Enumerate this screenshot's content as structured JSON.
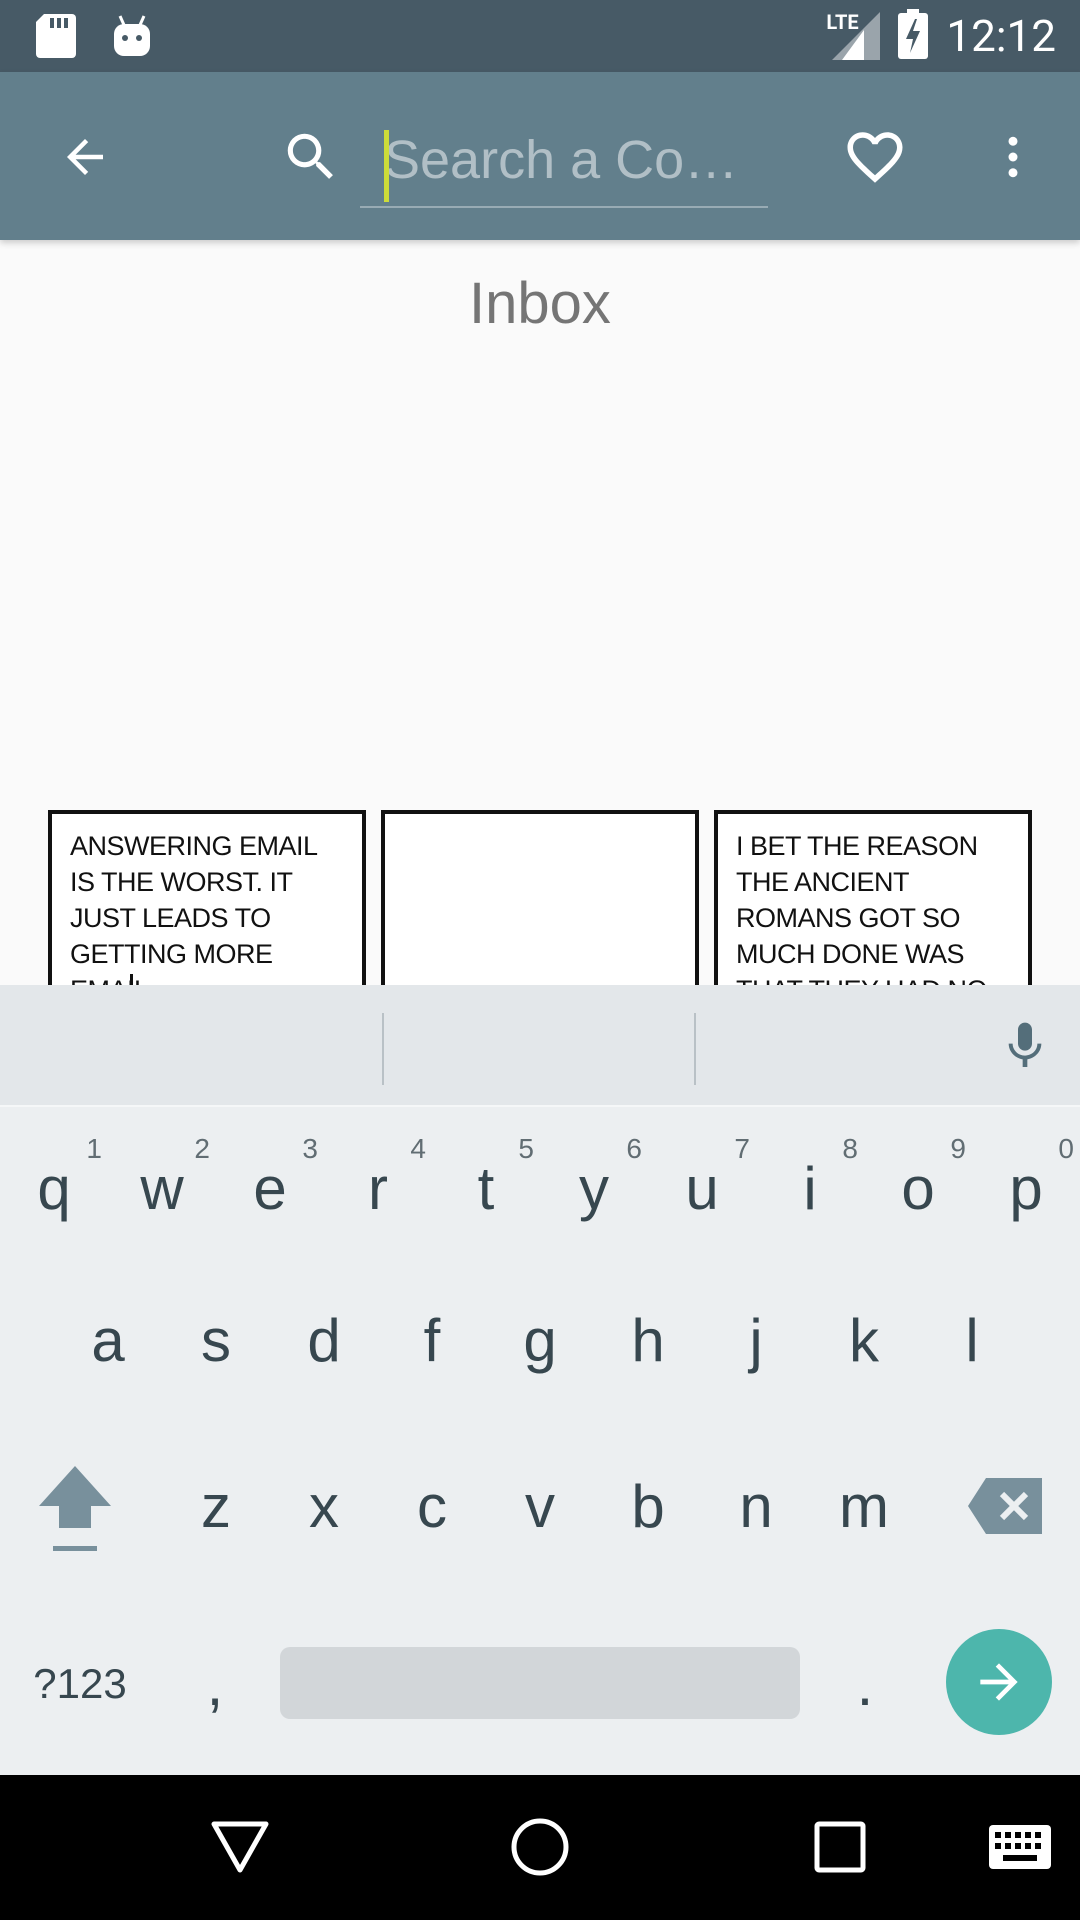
{
  "status_bar": {
    "time": "12:12",
    "network": "LTE"
  },
  "app_bar": {
    "search_placeholder": "Search a Co…"
  },
  "content": {
    "title": "Inbox",
    "panels": [
      {
        "text": "Answering email is the worst. It just leads to getting more email."
      },
      {
        "text": ""
      },
      {
        "text": "I bet the reason the ancient Romans got so much done was that they had no concept of inbox zero."
      }
    ]
  },
  "keyboard": {
    "row1": [
      {
        "key": "q",
        "hint": "1"
      },
      {
        "key": "w",
        "hint": "2"
      },
      {
        "key": "e",
        "hint": "3"
      },
      {
        "key": "r",
        "hint": "4"
      },
      {
        "key": "t",
        "hint": "5"
      },
      {
        "key": "y",
        "hint": "6"
      },
      {
        "key": "u",
        "hint": "7"
      },
      {
        "key": "i",
        "hint": "8"
      },
      {
        "key": "o",
        "hint": "9"
      },
      {
        "key": "p",
        "hint": "0"
      }
    ],
    "row2": [
      "a",
      "s",
      "d",
      "f",
      "g",
      "h",
      "j",
      "k",
      "l"
    ],
    "row3": [
      "z",
      "x",
      "c",
      "v",
      "b",
      "n",
      "m"
    ],
    "symbols_label": "?123",
    "comma": ",",
    "period": "."
  }
}
